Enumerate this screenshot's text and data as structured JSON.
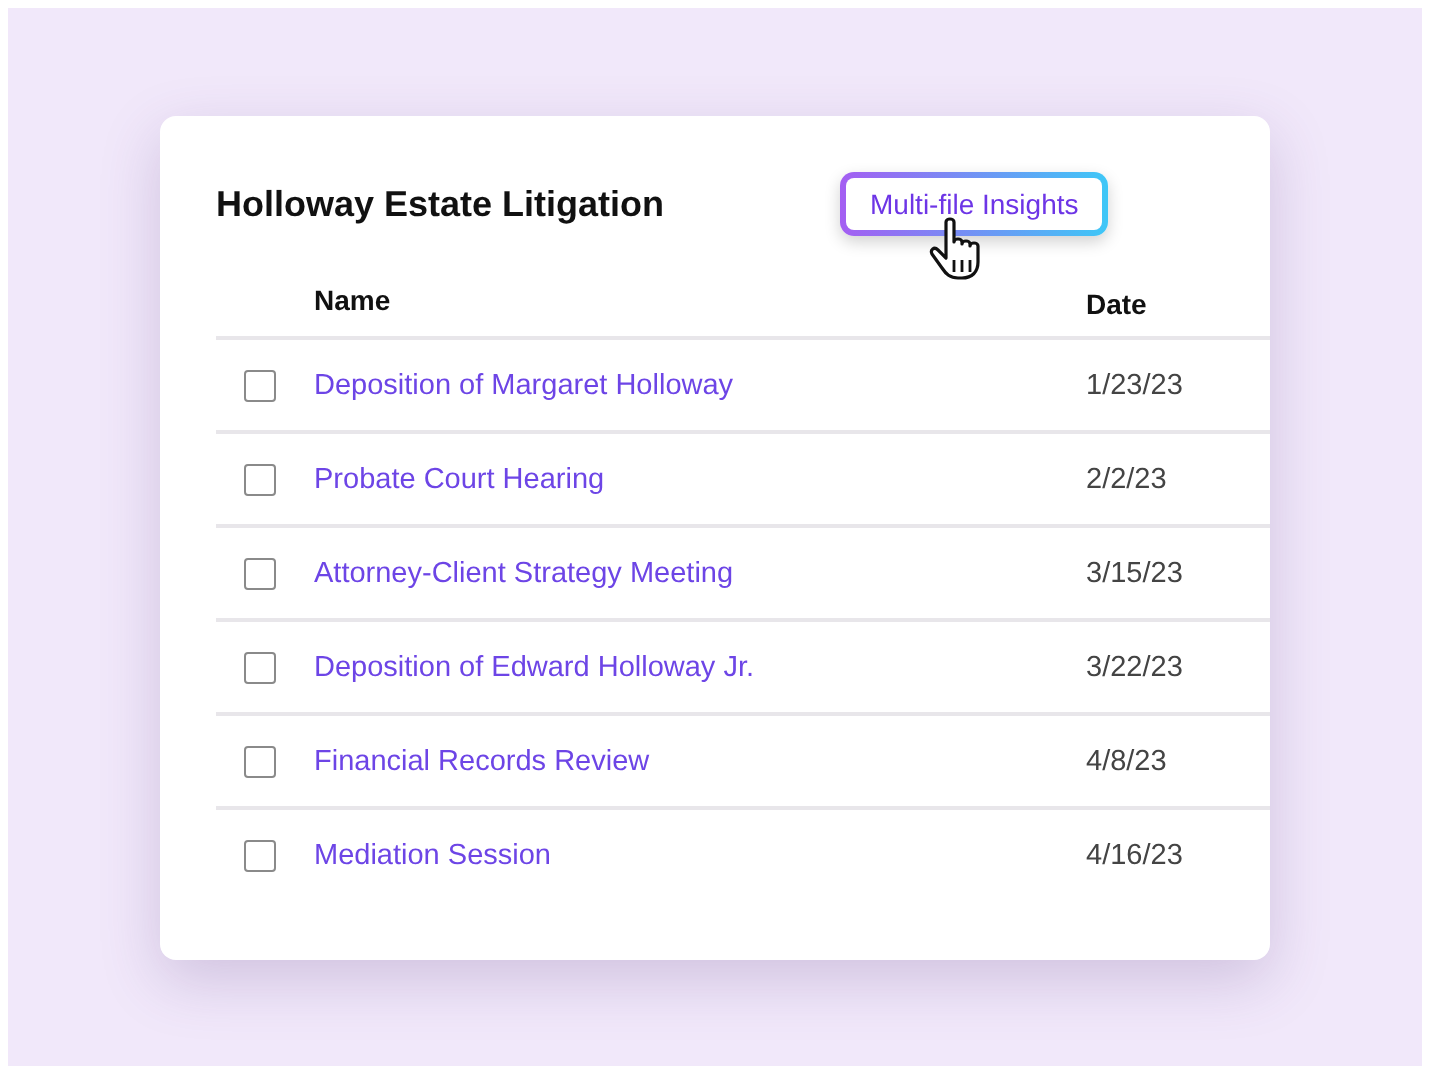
{
  "title": "Holloway Estate Litigation",
  "insights_button": {
    "label": "Multi-file Insights",
    "hovered": true
  },
  "table": {
    "columns": [
      "Name",
      "Date"
    ],
    "rows": [
      {
        "name": "Deposition of Margaret Holloway",
        "date": "1/23/23",
        "checked": false
      },
      {
        "name": "Probate Court Hearing",
        "date": "2/2/23",
        "checked": false
      },
      {
        "name": "Attorney-Client Strategy Meeting",
        "date": "3/15/23",
        "checked": false
      },
      {
        "name": "Deposition of Edward Holloway Jr.",
        "date": "3/22/23",
        "checked": false
      },
      {
        "name": "Financial Records Review",
        "date": "4/8/23",
        "checked": false
      },
      {
        "name": "Mediation Session",
        "date": "4/16/23",
        "checked": false
      }
    ]
  }
}
